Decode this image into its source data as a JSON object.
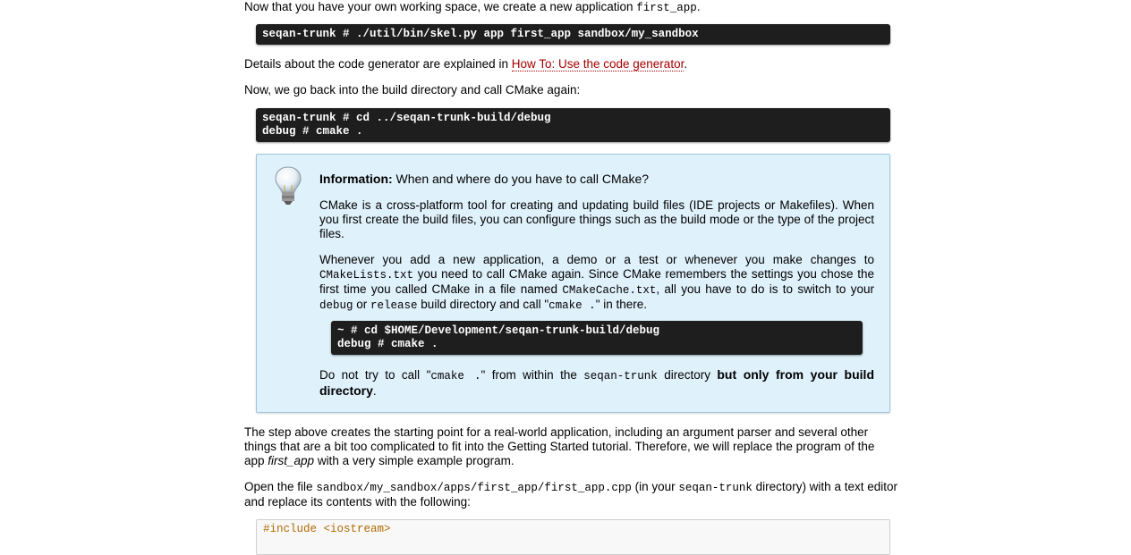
{
  "p1": {
    "before": "Now that you have your own working space, we create a new application ",
    "code": "first_app",
    "after": "."
  },
  "code1": {
    "line1": "seqan-trunk # ./util/bin/skel.py app first_app sandbox/my_sandbox"
  },
  "p2": {
    "before": "Details about the code generator are explained in ",
    "link": "How To: Use the code generator",
    "after": "."
  },
  "p3": {
    "text": "Now, we go back into the build directory and call CMake again:"
  },
  "code2": {
    "line1": "seqan-trunk # cd ../seqan-trunk-build/debug",
    "line2": "debug # cmake ."
  },
  "info": {
    "icon": "lightbulb-icon",
    "title_bold": "Information:",
    "title_rest": " When and where do you have to call CMake?",
    "para1": "CMake is a cross-platform tool for creating and updating build files (IDE projects or Makefiles). When you first create the build files, you can configure things such as the build mode or the type of the project files.",
    "para2": {
      "t1": "Whenever you add a new application, a demo or a test or whenever you make changes to ",
      "c1": "CMakeLists.txt",
      "t2": " you need to call CMake again. Since CMake remembers the settings you chose the first time you called CMake in a file named ",
      "c2": "CMakeCache.txt",
      "t3": ", all you have to do is to switch to your ",
      "c3": "debug",
      "t4": " or ",
      "c4": "release",
      "t5": " build directory and call \"",
      "c5": "cmake .",
      "t6": "\" in there."
    },
    "code": {
      "line1": "~ # cd $HOME/Development/seqan-trunk-build/debug",
      "line2": "debug # cmake ."
    },
    "para3": {
      "t1": "Do not try to call \"",
      "c1": "cmake .",
      "t2": "\" from within the ",
      "c2": "seqan-trunk",
      "t3": " directory ",
      "bold": "but only from your build directory",
      "t4": "."
    }
  },
  "p4": {
    "before": "The step above creates the starting point for a real-world application, including an argument parser and several other things that are a bit too complicated to fit into the Getting Started tutorial. Therefore, we will replace the program of the app ",
    "em": "first_app",
    "after": " with a very simple example program."
  },
  "p5": {
    "t1": "Open the file ",
    "c1": "sandbox/my_sandbox/apps/first_app/first_app.cpp",
    "t2": " (in your ",
    "c2": "seqan-trunk",
    "t3": " directory) with a text editor and replace its contents with the following:"
  },
  "code3": {
    "line1": "#include <iostream>"
  },
  "colors": {
    "accent_link": "#a40000",
    "info_bg": "#dff1fb",
    "code_bg": "#1e1e1e"
  }
}
